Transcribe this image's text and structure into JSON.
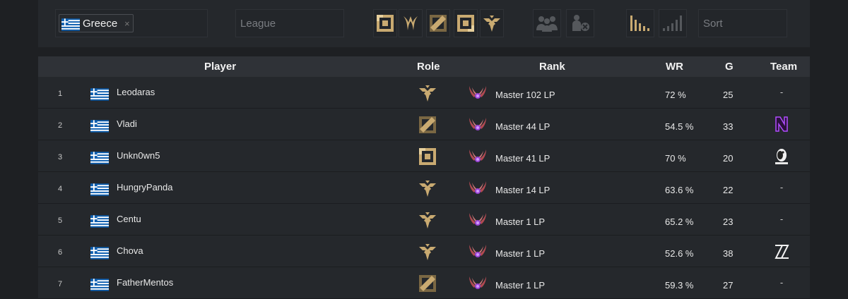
{
  "filters": {
    "country": {
      "label": "Greece",
      "remove": "×",
      "flag": "greece-flag-icon"
    },
    "league": {
      "placeholder": "League",
      "value": ""
    },
    "sort": {
      "placeholder": "Sort",
      "value": ""
    },
    "role_icons": [
      "top-lane-icon",
      "jungle-icon",
      "mid-lane-icon",
      "bot-lane-icon",
      "support-icon"
    ],
    "team_icons": [
      "in-team-icon",
      "no-team-icon"
    ],
    "sort_icons": [
      "sort-descending-icon",
      "sort-ascending-icon"
    ]
  },
  "colors": {
    "accent_gold": "#c9aa71",
    "row_bg": "#25282c",
    "header_bg": "#2f3237",
    "page_bg": "#1e2023"
  },
  "columns": {
    "player": "Player",
    "role": "Role",
    "rank": "Rank",
    "wr": "WR",
    "games": "G",
    "team": "Team"
  },
  "players": [
    {
      "num": "1",
      "name": "Leodaras",
      "role": "support-icon",
      "rank": "Master 102 LP",
      "wr": "72 %",
      "games": "25",
      "team": "-"
    },
    {
      "num": "2",
      "name": "Vladi",
      "role": "mid-lane-icon",
      "rank": "Master 44 LP",
      "wr": "54.5 %",
      "games": "33",
      "team": "team-logo-n"
    },
    {
      "num": "3",
      "name": "Unkn0wn5",
      "role": "top-lane-icon",
      "rank": "Master 41 LP",
      "wr": "70 %",
      "games": "20",
      "team": "team-logo-penguin"
    },
    {
      "num": "4",
      "name": "HungryPanda",
      "role": "support-icon",
      "rank": "Master 14 LP",
      "wr": "63.6 %",
      "games": "22",
      "team": "-"
    },
    {
      "num": "5",
      "name": "Centu",
      "role": "support-icon",
      "rank": "Master 1 LP",
      "wr": "65.2 %",
      "games": "23",
      "team": "-"
    },
    {
      "num": "6",
      "name": "Chova",
      "role": "support-icon",
      "rank": "Master 1 LP",
      "wr": "52.6 %",
      "games": "38",
      "team": "team-logo-z"
    },
    {
      "num": "7",
      "name": "FatherMentos",
      "role": "mid-lane-icon",
      "rank": "Master 1 LP",
      "wr": "59.3 %",
      "games": "27",
      "team": "-"
    }
  ]
}
